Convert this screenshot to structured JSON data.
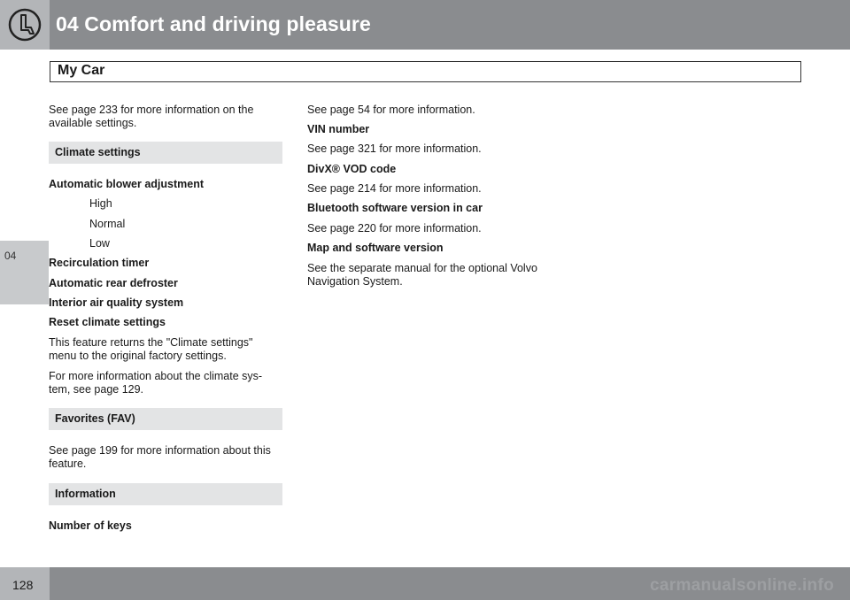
{
  "header": {
    "chapter_title": "04 Comfort and driving pleasure"
  },
  "section": {
    "title": "My Car"
  },
  "side_tab": {
    "label": "04"
  },
  "footer": {
    "page_number": "128",
    "watermark": "carmanualsonline.info"
  },
  "left_column": {
    "intro": [
      "See page 233 for more information on the",
      "available settings."
    ],
    "climate_heading": "Climate settings",
    "blower_heading": "Automatic blower adjustment",
    "blower_options": [
      "High",
      "Normal",
      "Low"
    ],
    "recirc": "Recirculation timer",
    "defroster": "Automatic rear defroster",
    "air_quality": "Interior air quality system",
    "reset": "Reset climate settings",
    "reset_text": [
      "This feature returns the \"Climate settings\"",
      "menu to the original factory settings."
    ],
    "more_info": [
      "For more information about the climate sys-",
      "tem, see page 129."
    ],
    "fav_heading": "Favorites (FAV)",
    "fav_text": [
      "See page 199 for more information about this",
      "feature."
    ],
    "info_heading": "Information",
    "keys": "Number of keys"
  },
  "right_column": {
    "keys_ref": "See page 54 for more information.",
    "vin": "VIN number",
    "vin_ref": "See page 321 for more information.",
    "divx": "DivX® VOD code",
    "divx_ref": "See page 214 for more information.",
    "bt": "Bluetooth software version in car",
    "bt_ref": "See page 220 for more information.",
    "map": "Map and software version",
    "map_text": [
      "See the separate manual for the optional Volvo",
      "Navigation System."
    ]
  }
}
